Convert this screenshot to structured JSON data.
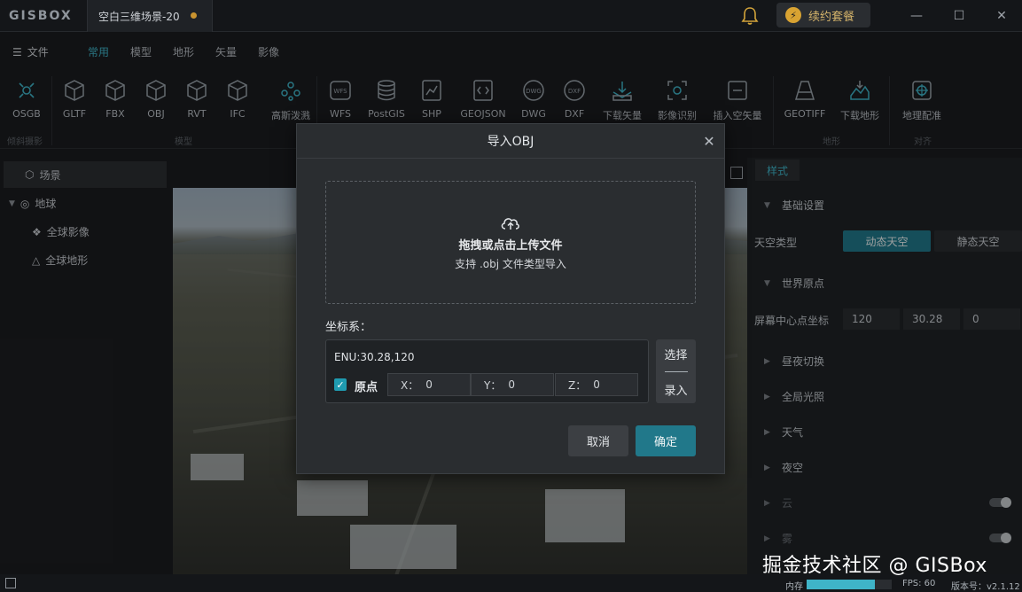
{
  "app": {
    "logo": "GISBOX",
    "doc_tab": "空白三维场景-20",
    "renew_label": "续约套餐"
  },
  "menu": {
    "file": "文件",
    "tabs": [
      "常用",
      "模型",
      "地形",
      "矢量",
      "影像"
    ],
    "active_tab": "常用"
  },
  "toolbar": {
    "tools": [
      {
        "label": "OSGB",
        "icon": "osgb-icon"
      },
      {
        "label": "GLTF",
        "icon": "cube-icon"
      },
      {
        "label": "FBX",
        "icon": "cube-icon"
      },
      {
        "label": "OBJ",
        "icon": "cube-icon"
      },
      {
        "label": "RVT",
        "icon": "cube-icon"
      },
      {
        "label": "IFC",
        "icon": "cube-icon"
      },
      {
        "label": "高斯泼溅",
        "icon": "gaussian-icon"
      },
      {
        "label": "WFS",
        "icon": "wfs-icon"
      },
      {
        "label": "PostGIS",
        "icon": "database-icon"
      },
      {
        "label": "SHP",
        "icon": "chart-file-icon"
      },
      {
        "label": "GEOJSON",
        "icon": "code-file-icon"
      },
      {
        "label": "DWG",
        "icon": "dwg-icon"
      },
      {
        "label": "DXF",
        "icon": "dxf-icon"
      },
      {
        "label": "下载矢量",
        "icon": "download-vector-icon"
      },
      {
        "label": "影像识别",
        "icon": "image-recognition-icon"
      },
      {
        "label": "插入空矢量",
        "icon": "insert-vector-icon"
      },
      {
        "label": "GEOTIFF",
        "icon": "geotiff-icon"
      },
      {
        "label": "下载地形",
        "icon": "download-terrain-icon"
      },
      {
        "label": "地理配准",
        "icon": "georeference-icon"
      }
    ],
    "groups": [
      "倾斜摄影",
      "模型",
      "地形",
      "对齐"
    ]
  },
  "tree": {
    "scene": "场景",
    "earth": "地球",
    "global_imagery": "全球影像",
    "global_terrain": "全球地形"
  },
  "style_panel": {
    "tab": "样式",
    "basic_settings": "基础设置",
    "sky_type_label": "天空类型",
    "sky_dynamic": "动态天空",
    "sky_static": "静态天空",
    "world_origin": "世界原点",
    "screen_center_label": "屏幕中心点坐标",
    "center_x": "120",
    "center_y": "30.28",
    "center_z": "0",
    "day_night": "昼夜切换",
    "global_light": "全局光照",
    "weather": "天气",
    "night_sky": "夜空",
    "cloud": "云",
    "fog": "雾"
  },
  "status": {
    "memory_label": "内存",
    "memory_fraction": 0.8,
    "fps": "FPS: 60",
    "version": "版本号：v2.1.12"
  },
  "watermark": "掘金技术社区 @ GISBox",
  "dialog": {
    "title": "导入OBJ",
    "drop_title": "拖拽或点击上传文件",
    "drop_sub": "支持 .obj 文件类型导入",
    "coord_label": "坐标系：",
    "coord_value": "ENU:30.28,120",
    "origin_label": "原点",
    "x_label": "X：",
    "x_value": "0",
    "y_label": "Y：",
    "y_value": "0",
    "z_label": "Z：",
    "z_value": "0",
    "select_label": "选择",
    "input_label": "录入",
    "cancel": "取消",
    "ok": "确定"
  }
}
